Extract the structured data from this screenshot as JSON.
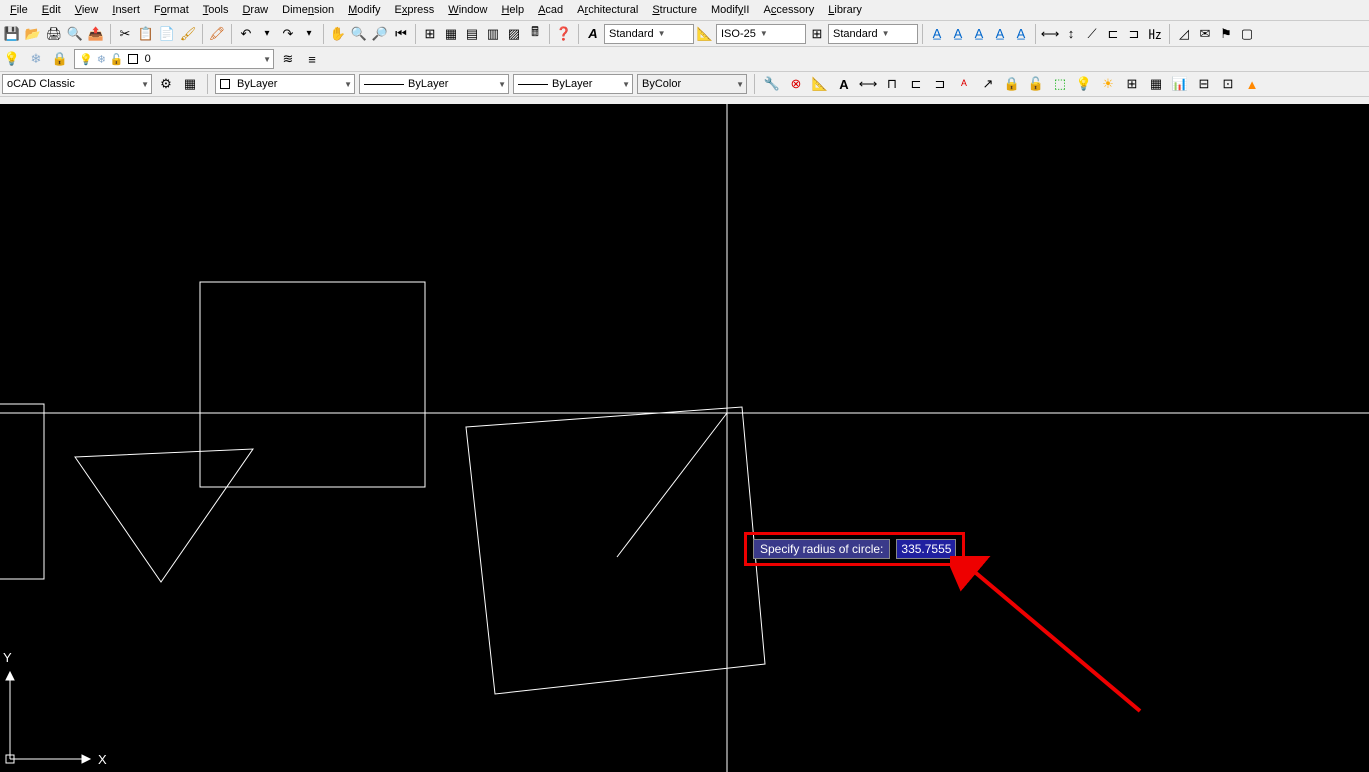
{
  "menu": [
    "File",
    "Edit",
    "View",
    "Insert",
    "Format",
    "Tools",
    "Draw",
    "Dimension",
    "Modify",
    "Express",
    "Window",
    "Help",
    "Acad",
    "Architectural",
    "Structure",
    "ModifyII",
    "Accessory",
    "Library"
  ],
  "tb1": {
    "text_style": "Standard",
    "dim_style": "ISO-25",
    "table_style": "Standard"
  },
  "layer": {
    "current": "0"
  },
  "styles": {
    "workspace": "oCAD Classic",
    "color": "ByLayer",
    "linetype": "ByLayer",
    "lineweight": "ByLayer",
    "plotstyle": "ByColor"
  },
  "dynamic": {
    "prompt": "Specify radius of circle:",
    "value": "335.7555"
  },
  "axis": {
    "x": "X",
    "y": "Y"
  }
}
